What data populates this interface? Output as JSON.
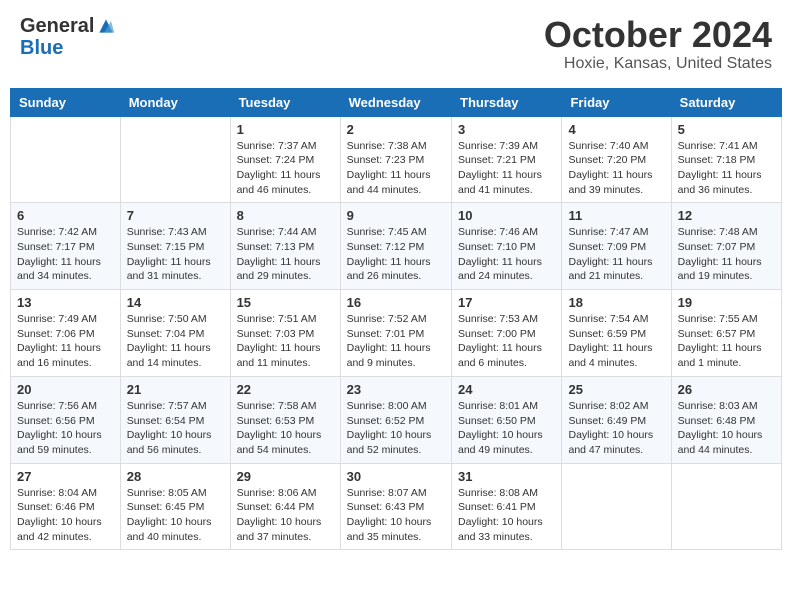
{
  "header": {
    "logo_general": "General",
    "logo_blue": "Blue",
    "month_title": "October 2024",
    "location": "Hoxie, Kansas, United States"
  },
  "days_of_week": [
    "Sunday",
    "Monday",
    "Tuesday",
    "Wednesday",
    "Thursday",
    "Friday",
    "Saturday"
  ],
  "weeks": [
    [
      {
        "day": "",
        "info": ""
      },
      {
        "day": "",
        "info": ""
      },
      {
        "day": "1",
        "info": "Sunrise: 7:37 AM\nSunset: 7:24 PM\nDaylight: 11 hours and 46 minutes."
      },
      {
        "day": "2",
        "info": "Sunrise: 7:38 AM\nSunset: 7:23 PM\nDaylight: 11 hours and 44 minutes."
      },
      {
        "day": "3",
        "info": "Sunrise: 7:39 AM\nSunset: 7:21 PM\nDaylight: 11 hours and 41 minutes."
      },
      {
        "day": "4",
        "info": "Sunrise: 7:40 AM\nSunset: 7:20 PM\nDaylight: 11 hours and 39 minutes."
      },
      {
        "day": "5",
        "info": "Sunrise: 7:41 AM\nSunset: 7:18 PM\nDaylight: 11 hours and 36 minutes."
      }
    ],
    [
      {
        "day": "6",
        "info": "Sunrise: 7:42 AM\nSunset: 7:17 PM\nDaylight: 11 hours and 34 minutes."
      },
      {
        "day": "7",
        "info": "Sunrise: 7:43 AM\nSunset: 7:15 PM\nDaylight: 11 hours and 31 minutes."
      },
      {
        "day": "8",
        "info": "Sunrise: 7:44 AM\nSunset: 7:13 PM\nDaylight: 11 hours and 29 minutes."
      },
      {
        "day": "9",
        "info": "Sunrise: 7:45 AM\nSunset: 7:12 PM\nDaylight: 11 hours and 26 minutes."
      },
      {
        "day": "10",
        "info": "Sunrise: 7:46 AM\nSunset: 7:10 PM\nDaylight: 11 hours and 24 minutes."
      },
      {
        "day": "11",
        "info": "Sunrise: 7:47 AM\nSunset: 7:09 PM\nDaylight: 11 hours and 21 minutes."
      },
      {
        "day": "12",
        "info": "Sunrise: 7:48 AM\nSunset: 7:07 PM\nDaylight: 11 hours and 19 minutes."
      }
    ],
    [
      {
        "day": "13",
        "info": "Sunrise: 7:49 AM\nSunset: 7:06 PM\nDaylight: 11 hours and 16 minutes."
      },
      {
        "day": "14",
        "info": "Sunrise: 7:50 AM\nSunset: 7:04 PM\nDaylight: 11 hours and 14 minutes."
      },
      {
        "day": "15",
        "info": "Sunrise: 7:51 AM\nSunset: 7:03 PM\nDaylight: 11 hours and 11 minutes."
      },
      {
        "day": "16",
        "info": "Sunrise: 7:52 AM\nSunset: 7:01 PM\nDaylight: 11 hours and 9 minutes."
      },
      {
        "day": "17",
        "info": "Sunrise: 7:53 AM\nSunset: 7:00 PM\nDaylight: 11 hours and 6 minutes."
      },
      {
        "day": "18",
        "info": "Sunrise: 7:54 AM\nSunset: 6:59 PM\nDaylight: 11 hours and 4 minutes."
      },
      {
        "day": "19",
        "info": "Sunrise: 7:55 AM\nSunset: 6:57 PM\nDaylight: 11 hours and 1 minute."
      }
    ],
    [
      {
        "day": "20",
        "info": "Sunrise: 7:56 AM\nSunset: 6:56 PM\nDaylight: 10 hours and 59 minutes."
      },
      {
        "day": "21",
        "info": "Sunrise: 7:57 AM\nSunset: 6:54 PM\nDaylight: 10 hours and 56 minutes."
      },
      {
        "day": "22",
        "info": "Sunrise: 7:58 AM\nSunset: 6:53 PM\nDaylight: 10 hours and 54 minutes."
      },
      {
        "day": "23",
        "info": "Sunrise: 8:00 AM\nSunset: 6:52 PM\nDaylight: 10 hours and 52 minutes."
      },
      {
        "day": "24",
        "info": "Sunrise: 8:01 AM\nSunset: 6:50 PM\nDaylight: 10 hours and 49 minutes."
      },
      {
        "day": "25",
        "info": "Sunrise: 8:02 AM\nSunset: 6:49 PM\nDaylight: 10 hours and 47 minutes."
      },
      {
        "day": "26",
        "info": "Sunrise: 8:03 AM\nSunset: 6:48 PM\nDaylight: 10 hours and 44 minutes."
      }
    ],
    [
      {
        "day": "27",
        "info": "Sunrise: 8:04 AM\nSunset: 6:46 PM\nDaylight: 10 hours and 42 minutes."
      },
      {
        "day": "28",
        "info": "Sunrise: 8:05 AM\nSunset: 6:45 PM\nDaylight: 10 hours and 40 minutes."
      },
      {
        "day": "29",
        "info": "Sunrise: 8:06 AM\nSunset: 6:44 PM\nDaylight: 10 hours and 37 minutes."
      },
      {
        "day": "30",
        "info": "Sunrise: 8:07 AM\nSunset: 6:43 PM\nDaylight: 10 hours and 35 minutes."
      },
      {
        "day": "31",
        "info": "Sunrise: 8:08 AM\nSunset: 6:41 PM\nDaylight: 10 hours and 33 minutes."
      },
      {
        "day": "",
        "info": ""
      },
      {
        "day": "",
        "info": ""
      }
    ]
  ]
}
